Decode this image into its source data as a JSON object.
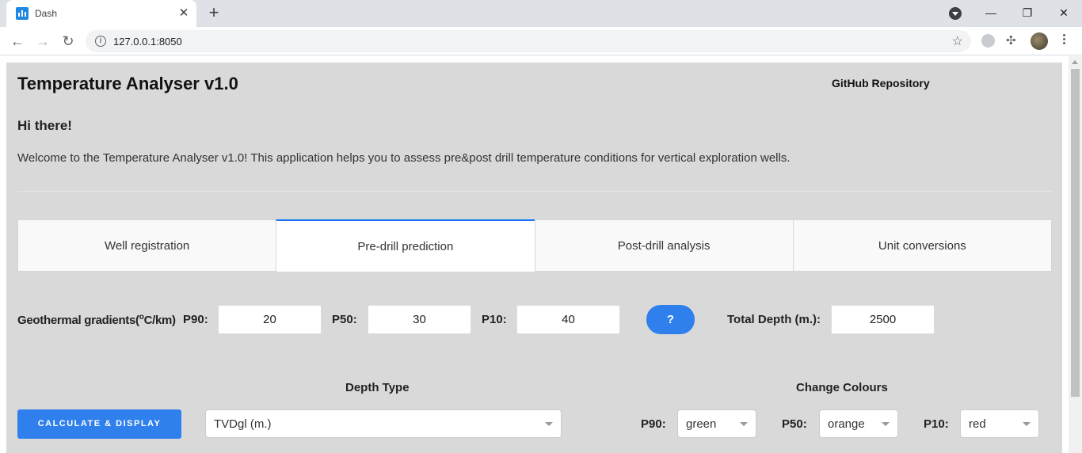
{
  "browser": {
    "tab_title": "Dash",
    "tab_close": "✕",
    "new_tab": "+",
    "url": "127.0.0.1:8050",
    "controls": {
      "minimize": "—",
      "restore": "❐",
      "close": "✕"
    },
    "nav": {
      "back": "←",
      "forward": "→",
      "reload": "↻"
    }
  },
  "header": {
    "title": "Temperature Analyser v1.0",
    "github_link": "GitHub Repository"
  },
  "intro": {
    "greeting": "Hi there!",
    "welcome": "Welcome to the Temperature Analyser v1.0! This application helps you to assess pre&post drill temperature conditions for vertical exploration wells."
  },
  "tabs": [
    {
      "label": "Well registration",
      "active": false
    },
    {
      "label": "Pre-drill prediction",
      "active": true
    },
    {
      "label": "Post-drill analysis",
      "active": false
    },
    {
      "label": "Unit conversions",
      "active": false
    }
  ],
  "gradients": {
    "label_prefix": "Geothermal gradients(",
    "label_sup": "o",
    "label_suffix": "C/km)",
    "p90_label": "P90:",
    "p90_value": "20",
    "p50_label": "P50:",
    "p50_value": "30",
    "p10_label": "P10:",
    "p10_value": "40",
    "help_button": "?",
    "total_depth_label": "Total Depth (m.):",
    "total_depth_value": "2500"
  },
  "depth": {
    "heading": "Depth Type",
    "selected": "TVDgl (m.)"
  },
  "colours": {
    "heading": "Change Colours",
    "p90_label": "P90:",
    "p90_value": "green",
    "p50_label": "P50:",
    "p50_value": "orange",
    "p10_label": "P10:",
    "p10_value": "red"
  },
  "actions": {
    "calculate": "CALCULATE & DISPLAY"
  },
  "theme": {
    "accent": "#2f80ed",
    "panel_bg": "#d9d9d9",
    "active_tab_border": "#1975fa"
  }
}
